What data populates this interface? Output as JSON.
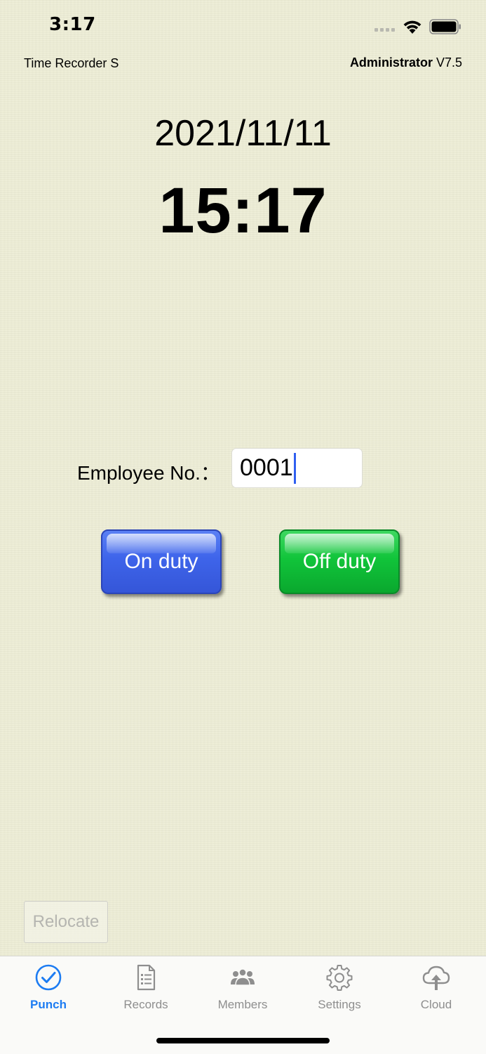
{
  "status_bar": {
    "time": "3:17"
  },
  "header": {
    "app_name": "Time Recorder S",
    "role": "Administrator",
    "version": "V7.5"
  },
  "clock": {
    "date": "2021/11/11",
    "time": "15:17"
  },
  "employee": {
    "label": "Employee No.：",
    "value": "0001"
  },
  "actions": {
    "on_duty_label": "On duty",
    "off_duty_label": "Off duty",
    "relocate_label": "Relocate"
  },
  "colors": {
    "on_duty": "#3e64ea",
    "off_duty": "#11c43a",
    "tab_active": "#1d7cf2",
    "tab_inactive": "#8e8e8e"
  },
  "tabs": [
    {
      "label": "Punch",
      "icon": "checkmark-circle-icon",
      "active": true
    },
    {
      "label": "Records",
      "icon": "document-list-icon",
      "active": false
    },
    {
      "label": "Members",
      "icon": "people-group-icon",
      "active": false
    },
    {
      "label": "Settings",
      "icon": "gear-icon",
      "active": false
    },
    {
      "label": "Cloud",
      "icon": "cloud-upload-icon",
      "active": false
    }
  ]
}
